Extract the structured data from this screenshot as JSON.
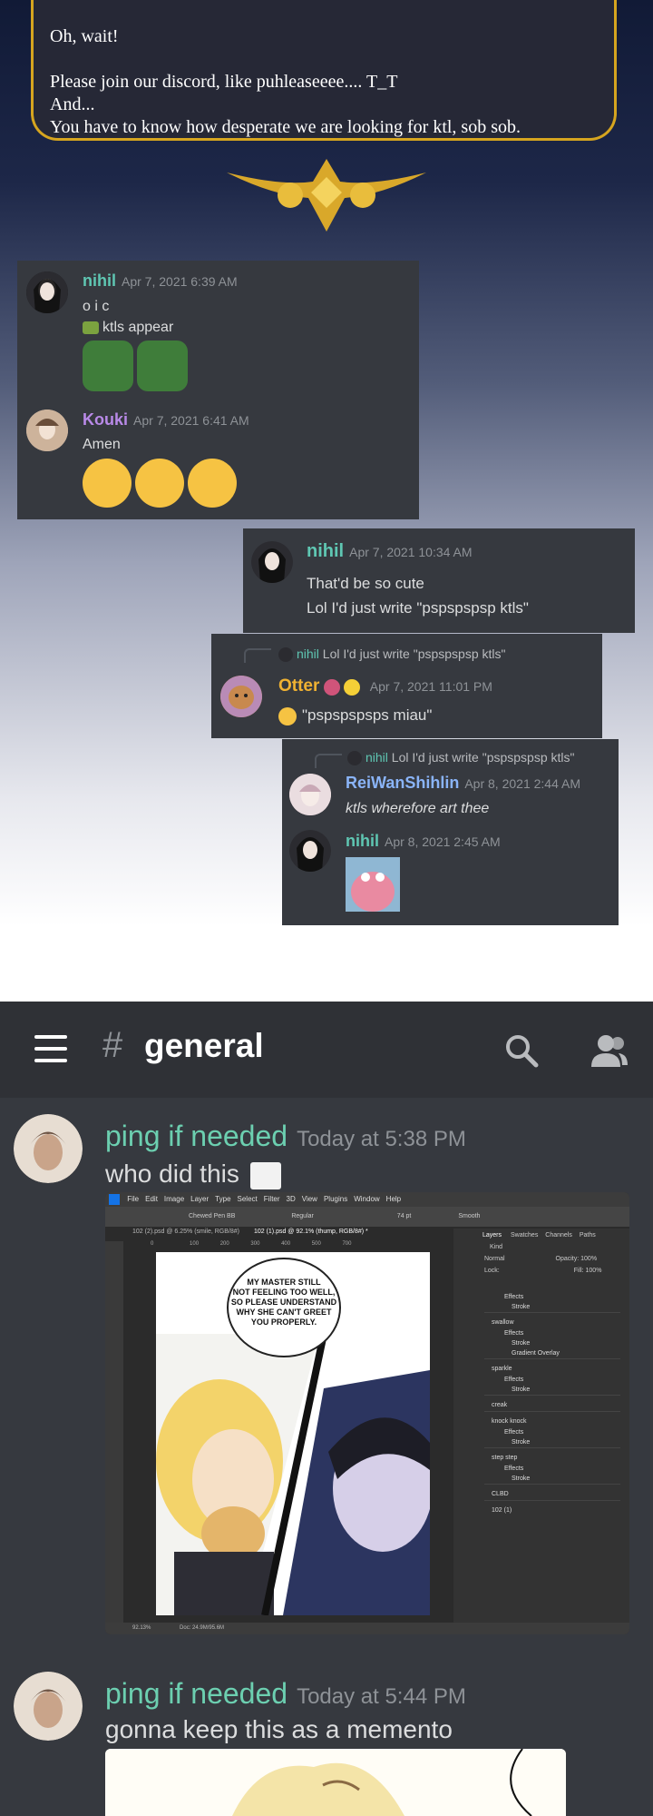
{
  "notice": {
    "line1": "Oh, wait!",
    "line2": "Please join our discord, like puhleaseeee.... T_T",
    "line3": "And...",
    "line4": "You have to know how desperate we are looking for ktl, sob sob."
  },
  "box1": {
    "m1": {
      "user": "nihil",
      "time": "Apr 7, 2021 6:39 AM",
      "line1": "o i c",
      "line2": "ktls appear"
    },
    "m2": {
      "user": "Kouki",
      "time": "Apr 7, 2021 6:41 AM",
      "line1": "Amen"
    }
  },
  "box2": {
    "user": "nihil",
    "time": "Apr 7, 2021 10:34 AM",
    "line1": "That'd be so cute",
    "line2": "Lol I'd just write \"pspspspsp ktls\""
  },
  "box3": {
    "reply_user": "nihil",
    "reply_text": "Lol I'd just write \"pspspspsp ktls\"",
    "user": "Otter",
    "time": "Apr 7, 2021 11:01 PM",
    "text": "\"pspspspsps miau\""
  },
  "box4": {
    "reply_user": "nihil",
    "reply_text": "Lol I'd just write \"pspspspsp ktls\"",
    "m1": {
      "user": "ReiWanShihlin",
      "time": "Apr 8, 2021 2:44 AM",
      "text": "ktls wherefore art thee"
    },
    "m2": {
      "user": "nihil",
      "time": "Apr 8, 2021 2:45 AM"
    }
  },
  "app": {
    "channel_hash": "#",
    "channel": "general",
    "msg1": {
      "user": "ping if needed",
      "time": "Today at 5:38 PM",
      "text": "who did this"
    },
    "ps_menu": [
      "File",
      "Edit",
      "Image",
      "Layer",
      "Type",
      "Select",
      "Filter",
      "3D",
      "View",
      "Plugins",
      "Window",
      "Help"
    ],
    "ps_tabs": [
      "102 (2).psd @ 6.25% (smile, RGB/8#)",
      "102 (1).psd @ 92.1% (thump, RGB/8#) *"
    ],
    "ps_options": {
      "font": "Chewed Pen BB",
      "style": "Regular",
      "size": "74 pt",
      "aa": "Smooth"
    },
    "ps_panel_tabs": [
      "Layers",
      "Swatches",
      "Channels",
      "Paths"
    ],
    "ps_kind": "Kind",
    "ps_blend": "Normal",
    "ps_opacity": "Opacity: 100%",
    "ps_lock": "Lock:",
    "ps_fill": "Fill: 100%",
    "ps_layers": [
      "Effects",
      "Stroke",
      "swallow",
      "Effects",
      "Stroke",
      "Gradient Overlay",
      "sparkle",
      "Effects",
      "Stroke",
      "creak",
      "knock knock",
      "Effects",
      "Stroke",
      "step step",
      "Effects",
      "Stroke",
      "CLBD",
      "102 (1)"
    ],
    "ps_status_zoom": "92.13%",
    "ps_status_doc": "Doc: 24.9M/95.6M",
    "bubble": [
      "MY MASTER STILL",
      "NOT FEELING TOO WELL,",
      "SO PLEASE UNDERSTAND",
      "WHY SHE CAN'T GREET",
      "YOU PROPERLY."
    ],
    "ruler": [
      "0",
      "100",
      "200",
      "300",
      "400",
      "500",
      "700"
    ],
    "msg2": {
      "user": "ping if needed",
      "time": "Today at 5:44 PM",
      "text": "gonna keep this as a memento"
    }
  },
  "colors": {
    "nihil": "#5fc7b3",
    "kouki": "#b98ae8",
    "otter": "#f0b232",
    "rei": "#8ab4f8",
    "ping": "#6ccfb0",
    "discord_bg": "#36393f"
  }
}
